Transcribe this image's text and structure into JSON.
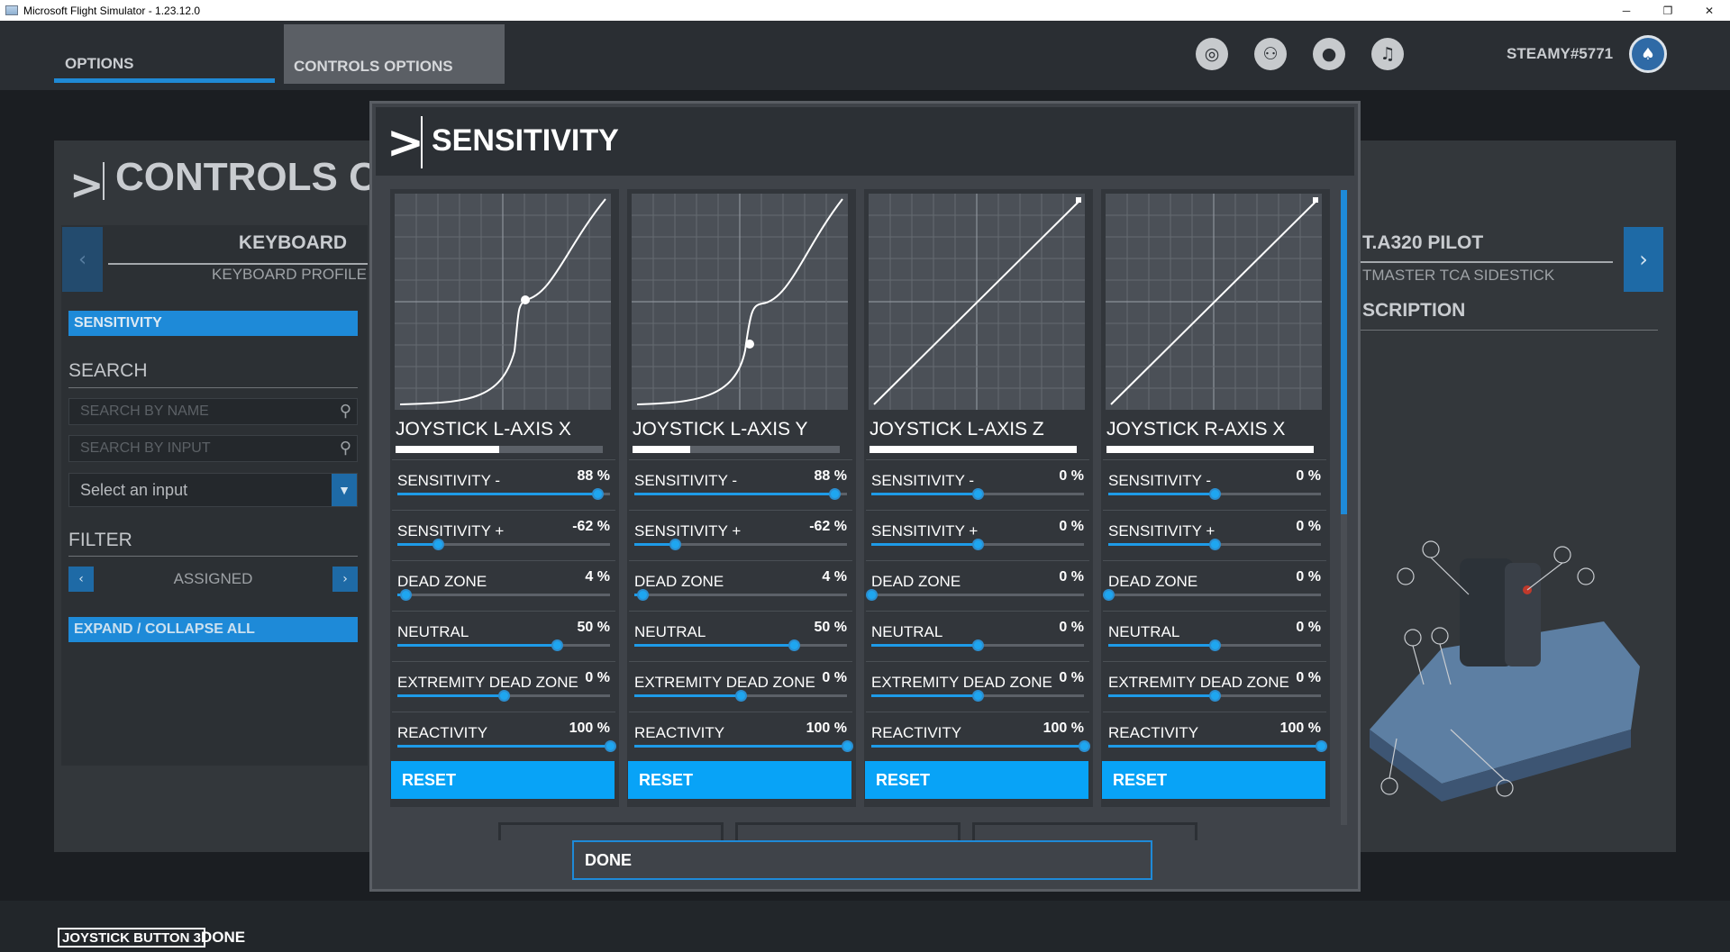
{
  "window": {
    "title": "Microsoft Flight Simulator - 1.23.12.0",
    "min": "─",
    "max": "❐",
    "close": "✕"
  },
  "nav": {
    "tab_options": "OPTIONS",
    "tab_controls": "CONTROLS OPTIONS",
    "username": "STEAMY#5771",
    "icons": [
      "activity-icon",
      "friends-icon",
      "profile-icon",
      "notifications-icon"
    ]
  },
  "background": {
    "page_title": "CONTROLS O",
    "left_device_title": "KEYBOARD",
    "left_device_profile": "KEYBOARD PROFILE",
    "sensitivity_label": "SENSITIVITY",
    "search_label": "SEARCH",
    "search_name_placeholder": "SEARCH BY NAME",
    "search_input_placeholder": "SEARCH BY INPUT",
    "select_input": "Select an input",
    "filter_label": "FILTER",
    "filter_value": "ASSIGNED",
    "expand_collapse": "EXPAND / COLLAPSE ALL",
    "right_device_title": "T.A320 PILOT",
    "right_device_profile": "TMASTER TCA SIDESTICK",
    "description_label": "SCRIPTION"
  },
  "modal": {
    "title": "SENSITIVITY",
    "done_label": "DONE",
    "axes": [
      {
        "name": "JOYSTICK L-AXIS X",
        "input_level": 0.5,
        "settings": [
          {
            "label": "SENSITIVITY -",
            "value": "88 %",
            "level": 0.94
          },
          {
            "label": "SENSITIVITY +",
            "value": "-62 %",
            "level": 0.19
          },
          {
            "label": "DEAD ZONE",
            "value": "4 %",
            "level": 0.04
          },
          {
            "label": "NEUTRAL",
            "value": "50 %",
            "level": 0.75
          },
          {
            "label": "EXTREMITY DEAD ZONE",
            "value": "0 %",
            "level": 0.5
          },
          {
            "label": "REACTIVITY",
            "value": "100 %",
            "level": 1.0
          }
        ],
        "reset_label": "RESET"
      },
      {
        "name": "JOYSTICK L-AXIS Y",
        "input_level": 0.28,
        "settings": [
          {
            "label": "SENSITIVITY -",
            "value": "88 %",
            "level": 0.94
          },
          {
            "label": "SENSITIVITY +",
            "value": "-62 %",
            "level": 0.19
          },
          {
            "label": "DEAD ZONE",
            "value": "4 %",
            "level": 0.04
          },
          {
            "label": "NEUTRAL",
            "value": "50 %",
            "level": 0.75
          },
          {
            "label": "EXTREMITY DEAD ZONE",
            "value": "0 %",
            "level": 0.5
          },
          {
            "label": "REACTIVITY",
            "value": "100 %",
            "level": 1.0
          }
        ],
        "reset_label": "RESET"
      },
      {
        "name": "JOYSTICK L-AXIS Z",
        "input_level": 1.0,
        "settings": [
          {
            "label": "SENSITIVITY -",
            "value": "0 %",
            "level": 0.5
          },
          {
            "label": "SENSITIVITY +",
            "value": "0 %",
            "level": 0.5
          },
          {
            "label": "DEAD ZONE",
            "value": "0 %",
            "level": 0.0
          },
          {
            "label": "NEUTRAL",
            "value": "0 %",
            "level": 0.5
          },
          {
            "label": "EXTREMITY DEAD ZONE",
            "value": "0 %",
            "level": 0.5
          },
          {
            "label": "REACTIVITY",
            "value": "100 %",
            "level": 1.0
          }
        ],
        "reset_label": "RESET"
      },
      {
        "name": "JOYSTICK R-AXIS X",
        "input_level": 1.0,
        "settings": [
          {
            "label": "SENSITIVITY -",
            "value": "0 %",
            "level": 0.5
          },
          {
            "label": "SENSITIVITY +",
            "value": "0 %",
            "level": 0.5
          },
          {
            "label": "DEAD ZONE",
            "value": "0 %",
            "level": 0.0
          },
          {
            "label": "NEUTRAL",
            "value": "0 %",
            "level": 0.5
          },
          {
            "label": "EXTREMITY DEAD ZONE",
            "value": "0 %",
            "level": 0.5
          },
          {
            "label": "REACTIVITY",
            "value": "100 %",
            "level": 1.0
          }
        ],
        "reset_label": "RESET"
      }
    ]
  },
  "bottom": {
    "hint_button": "JOYSTICK BUTTON 3",
    "hint_action": "DONE"
  },
  "colors": {
    "accent": "#08a3f7",
    "panel": "#32363b",
    "modal": "#3f4349"
  }
}
